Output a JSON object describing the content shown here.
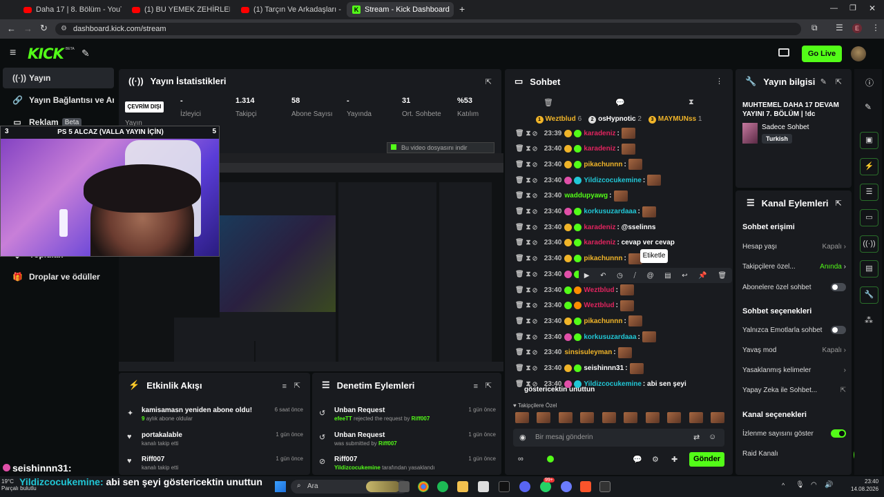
{
  "browser": {
    "tabs": [
      {
        "label": "Daha 17 | 8. Bölüm - YouTube",
        "active": false
      },
      {
        "label": "(1) BU YEMEK ZEHİRLER! EFE U",
        "active": false
      },
      {
        "label": "(1) Tarçın Ve Arkadaşları - Jene",
        "active": false
      },
      {
        "label": "Stream - Kick Dashboard",
        "active": true
      }
    ],
    "url": "dashboard.kick.com/stream",
    "profile_initial": "E"
  },
  "topnav": {
    "logo": "KICK",
    "logo_beta": "BETA",
    "go_live": "Go Live"
  },
  "sidebar": {
    "items": [
      {
        "label": "Yayın",
        "icon": "broadcast-icon"
      },
      {
        "label": "Yayın Bağlantısı ve Anahtar",
        "icon": "link-icon"
      },
      {
        "label": "Reklam",
        "badge": "Beta",
        "icon": "ad-icon"
      },
      {
        "label": "Yoplulak",
        "icon": "community-icon"
      },
      {
        "label": "Droplar ve ödüller",
        "icon": "gift-icon"
      }
    ]
  },
  "stats": {
    "title": "Yayın İstatistikleri",
    "status": "ÇEVRİM DIŞI",
    "status_label": "Yayın",
    "items": [
      {
        "value": "-",
        "label": "İzleyici"
      },
      {
        "value": "1.314",
        "label": "Takipçi"
      },
      {
        "value": "58",
        "label": "Abone Sayısı"
      },
      {
        "value": "-",
        "label": "Yayında Olduğu Süre"
      },
      {
        "value": "31",
        "label": "Ort. Sohbete Katılanlar"
      },
      {
        "value": "%53",
        "label": "Katılım"
      }
    ],
    "download_bar": "Bu video dosyasını indir"
  },
  "webcam": {
    "title": "PS 5 ALCAZ (VALLA YAYIN İÇİN)",
    "left_num": "3",
    "right_num": "5"
  },
  "chat": {
    "title": "Sohbet",
    "top": [
      {
        "name": "Weztblud",
        "count": "6"
      },
      {
        "name": "osHypnotic",
        "count": "2"
      },
      {
        "name": "MAYMUNss",
        "count": "1"
      }
    ],
    "messages": [
      {
        "time": "23:39",
        "user": "karadeniz",
        "color": "#e0245e",
        "text": ":",
        "emote": true
      },
      {
        "time": "23:40",
        "user": "karadeniz",
        "color": "#e0245e",
        "text": ":",
        "emote": true
      },
      {
        "time": "23:40",
        "user": "pikachunnn",
        "color": "#f0b429",
        "text": ":",
        "emote": true
      },
      {
        "time": "23:40",
        "user": "Yildizcocukemine",
        "color": "#21c7d6",
        "text": ":",
        "emote": true
      },
      {
        "time": "23:40",
        "user": "waddupyawg",
        "color": "#53fc18",
        "text": ":",
        "emote": true
      },
      {
        "time": "23:40",
        "user": "korkusuzardaaa",
        "color": "#21c7d6",
        "text": ":",
        "emote": true
      },
      {
        "time": "23:40",
        "user": "karadeniz",
        "color": "#e0245e",
        "text": ": @sselinns",
        "emote": false
      },
      {
        "time": "23:40",
        "user": "karadeniz",
        "color": "#e0245e",
        "text": ": cevap ver cevap",
        "emote": false
      },
      {
        "time": "23:40",
        "user": "pikachunnn",
        "color": "#f0b429",
        "text": ":",
        "emote": true
      },
      {
        "time": "23:40",
        "user": "",
        "color": "#e0245e",
        "text": "",
        "emote": false
      },
      {
        "time": "23:40",
        "user": "Weztblud",
        "color": "#e0245e",
        "text": ":",
        "emote": true
      },
      {
        "time": "23:40",
        "user": "Weztblud",
        "color": "#e0245e",
        "text": ":",
        "emote": true
      },
      {
        "time": "23:40",
        "user": "pikachunnn",
        "color": "#f0b429",
        "text": ":",
        "emote": true
      },
      {
        "time": "23:40",
        "user": "korkusuzardaaa",
        "color": "#21c7d6",
        "text": ":",
        "emote": true
      },
      {
        "time": "23:40",
        "user": "sinsisuleyman",
        "color": "#f0b429",
        "text": ":",
        "emote": true
      },
      {
        "time": "23:40",
        "user": "seishinnn31",
        "color": "#fff",
        "text": ":",
        "emote": true
      },
      {
        "time": "23:40",
        "user": "Yildizcocukemine",
        "color": "#21c7d6",
        "text": ": abi sen şeyi",
        "emote": false
      }
    ],
    "last_continuation": "göstericektin unuttun",
    "tooltip": "Etiketle",
    "followers_only": "Takipçilere Özel",
    "input_placeholder": "Bir mesaj gönderin",
    "send": "Gönder"
  },
  "stream_info": {
    "title": "Yayın bilgisi",
    "stream_title": "MUHTEMEL DAHA 17 DEVAM YAYINI 7. BÖLÜM | !dc",
    "category": "Sadece Sohbet",
    "language": "Turkish"
  },
  "channel_actions": {
    "title": "Kanal Eylemleri",
    "chat_access": "Sohbet erişimi",
    "account_age": {
      "label": "Hesap yaşı",
      "value": "Kapalı"
    },
    "followers_only": {
      "label": "Takipçilere özel...",
      "value": "Anında"
    },
    "subs_only": {
      "label": "Abonelere özel sohbet"
    },
    "chat_options": "Sohbet seçenekleri",
    "emote_only": {
      "label": "Yalnızca Emotlarla sohbet"
    },
    "slow_mode": {
      "label": "Yavaş mod",
      "value": "Kapalı"
    },
    "banned_words": {
      "label": "Yasaklanmış kelimeler"
    },
    "ai_chat": {
      "label": "Yapay Zeka ile Sohbet..."
    },
    "channel_options": "Kanal seçenekleri",
    "show_viewers": {
      "label": "İzlenme sayısını göster",
      "on": true
    },
    "raid": {
      "label": "Raid Kanalı"
    }
  },
  "activity": {
    "title": "Etkinlik Akışı",
    "items": [
      {
        "title": "kamisamasn yeniden abone oldu!",
        "sub_num": "9",
        "sub": "aylık abone oldular",
        "time": "6 saat önce"
      },
      {
        "title": "portakalable",
        "sub": "kanalı takip etti",
        "time": "1 gün önce"
      },
      {
        "title": "Riff007",
        "sub": "kanalı takip etti",
        "time": "1 gün önce"
      }
    ]
  },
  "moderation": {
    "title": "Denetim Eylemleri",
    "items": [
      {
        "title": "Unban Request",
        "user": "efeeTT",
        "mid": "rejected the request by",
        "user2": "Riff007",
        "time": "1 gün önce"
      },
      {
        "title": "Unban Request",
        "user": "",
        "mid": "was submitted by",
        "user2": "Riff007",
        "time": "1 gün önce"
      },
      {
        "title": "Riff007",
        "user": "Yildizcocukemine",
        "mid": "tarafından yasaklandı",
        "user2": "",
        "time": "1 gün önce"
      }
    ]
  },
  "overlay": {
    "user": "seishinnn31:",
    "msg_user": "Yildizcocukemine:",
    "msg": "abi sen şeyi göstericektin unuttun"
  },
  "taskbar": {
    "search": "Ara",
    "weather": "19°C",
    "weather_sub": "Parçalı bulutlu",
    "time": "23:40",
    "date": "14.08.2026",
    "badge_1": "99+"
  }
}
